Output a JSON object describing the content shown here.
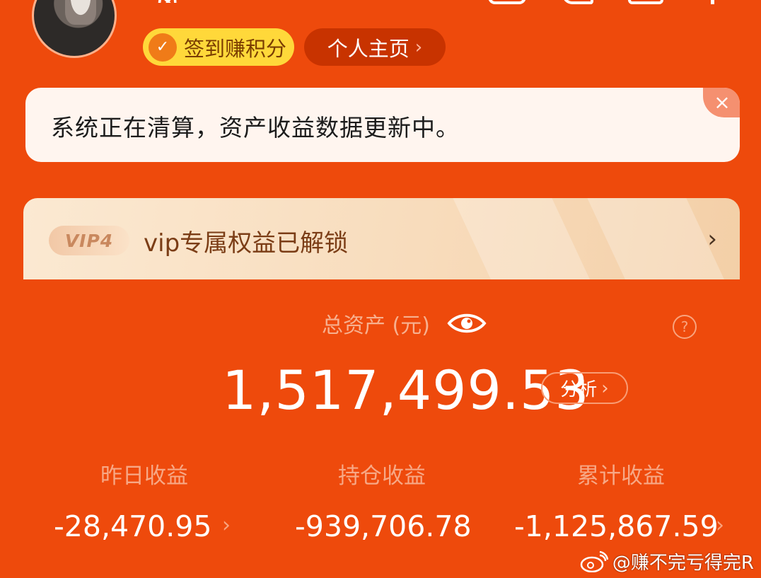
{
  "header": {
    "username_partial": "凤",
    "checkin_label": "签到赚积分",
    "profile_label": "个人主页",
    "chevron": "›",
    "icons": [
      "scan-icon",
      "message-icon",
      "mail-icon",
      "more-icon"
    ]
  },
  "notice": {
    "text": "系统正在清算，资产收益数据更新中。",
    "close_glyph": "×"
  },
  "vip": {
    "badge": "VIP4",
    "text": "vip专属权益已解锁",
    "chevron": "›"
  },
  "assets": {
    "total_label": "总资产 (元)",
    "total_value": "1,517,499.53",
    "help_glyph": "?",
    "analyze_label": "分析",
    "chevron": "›",
    "stats": [
      {
        "label": "昨日收益",
        "value": "-28,470.95"
      },
      {
        "label": "持仓收益",
        "value": "-939,706.78"
      },
      {
        "label": "累计收益",
        "value": "-1,125,867.59"
      }
    ]
  },
  "watermark": {
    "text": "@赚不完亏得完R"
  },
  "colors": {
    "background": "#ee4a0c",
    "checkin": "#ffd83a",
    "notice_bg": "#fff5ef",
    "vip_text": "#7b3d16"
  }
}
